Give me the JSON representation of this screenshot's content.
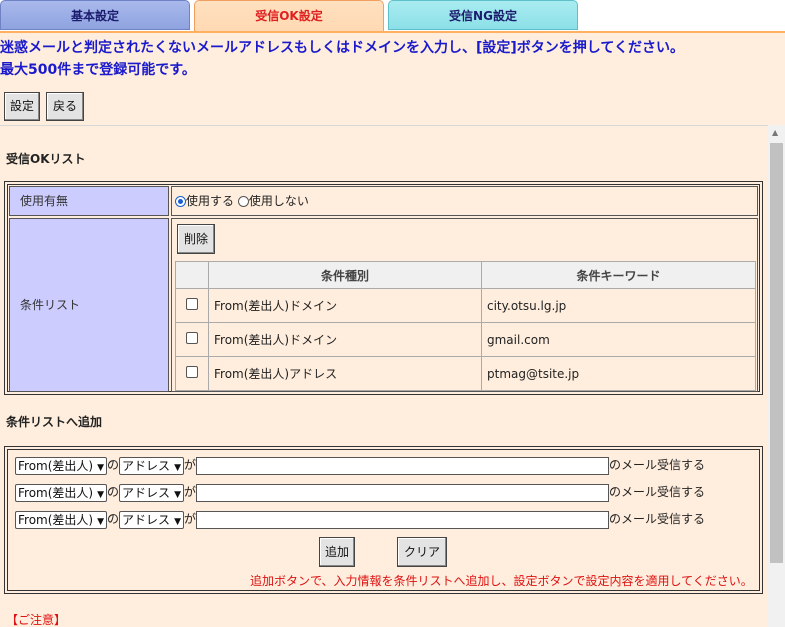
{
  "tabs": {
    "basic": "基本設定",
    "ok": "受信OK設定",
    "ng": "受信NG設定"
  },
  "header": {
    "message_line1": "迷惑メールと判定されたくないメールアドレスもしくはドメインを入力し、[設定]ボタンを押してください。",
    "message_line2": "最大500件まで登録可能です。",
    "set_button": "設定",
    "back_button": "戻る"
  },
  "ok_list": {
    "title": "受信OKリスト",
    "usage_label": "使用有無",
    "use_option": "使用する",
    "nouse_option": "使用しない",
    "use_selected": "使用する",
    "condition_label": "条件リスト",
    "delete_button": "削除",
    "columns": [
      "条件種別",
      "条件キーワード"
    ],
    "rows": [
      {
        "type": "From(差出人)ドメイン",
        "keyword": "city.otsu.lg.jp"
      },
      {
        "type": "From(差出人)ドメイン",
        "keyword": "gmail.com"
      },
      {
        "type": "From(差出人)アドレス",
        "keyword": "ptmag@tsite.jp"
      }
    ]
  },
  "add": {
    "title": "条件リストへ追加",
    "sender_option": "From(差出人)",
    "no_label": "の",
    "target_option": "アドレス",
    "ga_label": "が",
    "suffix": "のメール受信する",
    "add_button": "追加",
    "clear_button": "クリア",
    "hint": "追加ボタンで、入力情報を条件リストへ追加し、設定ボタンで設定内容を適用してください。"
  },
  "caution": "【ご注意】",
  "colors": {
    "ok_tab_text": "#e02020",
    "message_text": "#1a1acc",
    "panel_bg": "#ffeedd",
    "label_bg": "#ccccff",
    "hint_text": "#dd1111"
  }
}
